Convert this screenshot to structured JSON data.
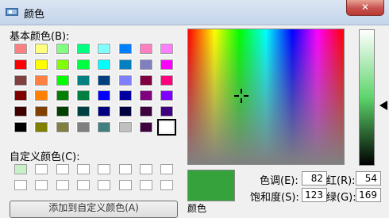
{
  "window": {
    "title": "颜色",
    "close_label": "✕"
  },
  "basic_colors": {
    "label": "基本颜色(B):",
    "swatches": [
      "#ff8080",
      "#ffff80",
      "#80ff80",
      "#00ff80",
      "#80ffff",
      "#0080ff",
      "#ff80c0",
      "#ff80ff",
      "#ff0000",
      "#ffff00",
      "#80ff00",
      "#00ff40",
      "#00ffff",
      "#0080c0",
      "#8080c0",
      "#ff00ff",
      "#804040",
      "#ff8040",
      "#00ff00",
      "#008080",
      "#004080",
      "#8080ff",
      "#800040",
      "#ff0080",
      "#800000",
      "#ff8000",
      "#008000",
      "#008040",
      "#0000ff",
      "#0000a0",
      "#800080",
      "#8000ff",
      "#400000",
      "#804000",
      "#004000",
      "#004040",
      "#000080",
      "#000040",
      "#400040",
      "#400080",
      "#000000",
      "#808000",
      "#808040",
      "#808080",
      "#408080",
      "#c0c0c0",
      "#400040",
      "#ffffff"
    ],
    "selected_index": 47
  },
  "custom_colors": {
    "label": "自定义颜色(C):",
    "swatches": [
      "#c8f0c8",
      "#ffffff",
      "#ffffff",
      "#ffffff",
      "#ffffff",
      "#ffffff",
      "#ffffff",
      "#ffffff",
      "#ffffff",
      "#ffffff",
      "#ffffff",
      "#ffffff",
      "#ffffff",
      "#ffffff",
      "#ffffff",
      "#ffffff"
    ]
  },
  "preview": {
    "color": "#35a23c",
    "label": "颜色"
  },
  "fields": {
    "hue": {
      "label": "色调(E):",
      "value": "82"
    },
    "saturation": {
      "label": "饱和度(S):",
      "value": "123"
    },
    "red": {
      "label": "红(R):",
      "value": "54"
    },
    "green": {
      "label": "绿(G):",
      "value": "169"
    }
  },
  "add_button": {
    "label": "添加到自定义颜色(A)"
  }
}
